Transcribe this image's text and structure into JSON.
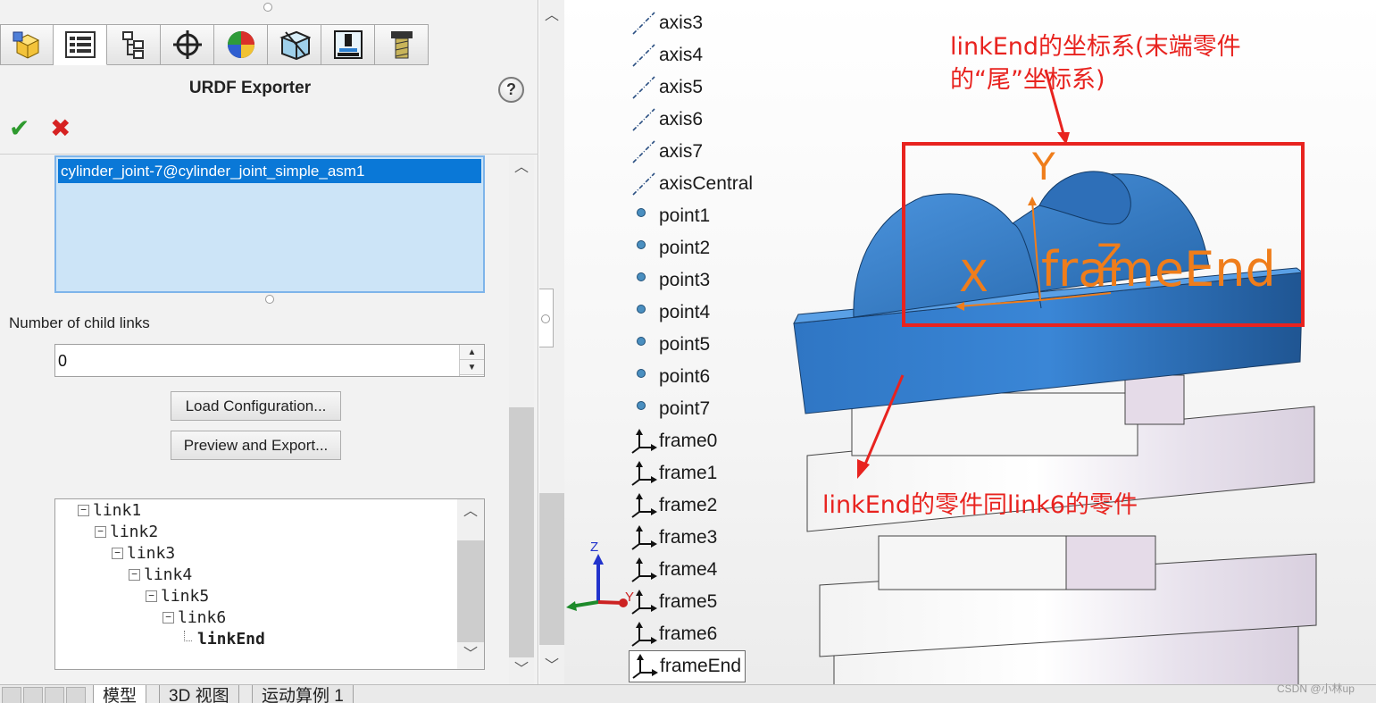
{
  "panel": {
    "title": "URDF Exporter",
    "help_label": "?",
    "ok_icon": "check-icon",
    "cancel_icon": "x-icon",
    "tabs": [
      {
        "name": "feature-manager",
        "icon": "part-cube-icon"
      },
      {
        "name": "property-manager",
        "icon": "property-list-icon"
      },
      {
        "name": "configuration-manager",
        "icon": "config-tree-icon"
      },
      {
        "name": "dimxpert-manager",
        "icon": "crosshair-icon"
      },
      {
        "name": "display-manager",
        "icon": "appearance-ball-icon"
      },
      {
        "name": "cam-manager",
        "icon": "cube-3d-icon"
      },
      {
        "name": "cam-tree",
        "icon": "machine-icon"
      },
      {
        "name": "tool-manager",
        "icon": "drill-icon"
      }
    ],
    "selection_value": "cylinder_joint-7@cylinder_joint_simple_asm1",
    "child_links_label": "Number of child links",
    "child_links_value": "0",
    "load_config_label": "Load Configuration...",
    "preview_export_label": "Preview and Export..."
  },
  "link_tree": [
    {
      "label": "link1",
      "level": 0,
      "expander": "⊟"
    },
    {
      "label": "link2",
      "level": 1,
      "expander": "⊟"
    },
    {
      "label": "link3",
      "level": 2,
      "expander": "⊟"
    },
    {
      "label": "link4",
      "level": 3,
      "expander": "⊟"
    },
    {
      "label": "link5",
      "level": 4,
      "expander": "⊟"
    },
    {
      "label": "link6",
      "level": 5,
      "expander": "⊟"
    },
    {
      "label": "linkEnd",
      "level": 6,
      "expander": ""
    }
  ],
  "bottom_tabs": [
    "模型",
    "3D 视图",
    "运动算例 1"
  ],
  "feature_tree": [
    {
      "label": "axis3",
      "type": "axis"
    },
    {
      "label": "axis4",
      "type": "axis"
    },
    {
      "label": "axis5",
      "type": "axis"
    },
    {
      "label": "axis6",
      "type": "axis"
    },
    {
      "label": "axis7",
      "type": "axis"
    },
    {
      "label": "axisCentral",
      "type": "axis"
    },
    {
      "label": "point1",
      "type": "point"
    },
    {
      "label": "point2",
      "type": "point"
    },
    {
      "label": "point3",
      "type": "point"
    },
    {
      "label": "point4",
      "type": "point"
    },
    {
      "label": "point5",
      "type": "point"
    },
    {
      "label": "point6",
      "type": "point"
    },
    {
      "label": "point7",
      "type": "point"
    },
    {
      "label": "frame0",
      "type": "frame"
    },
    {
      "label": "frame1",
      "type": "frame"
    },
    {
      "label": "frame2",
      "type": "frame"
    },
    {
      "label": "frame3",
      "type": "frame"
    },
    {
      "label": "frame4",
      "type": "frame"
    },
    {
      "label": "frame5",
      "type": "frame"
    },
    {
      "label": "frame6",
      "type": "frame"
    },
    {
      "label": "frameEnd",
      "type": "frame",
      "selected": true
    }
  ],
  "annotations": {
    "top_line1": "linkEnd的坐标系(末端零件",
    "top_line2": "的“尾”坐标系)",
    "bottom": "linkEnd的零件同link6的零件"
  },
  "frame_labels": {
    "y_axis": "Y",
    "x_axis": "X",
    "z_axis": "Z",
    "name": "frameEnd"
  },
  "triad": {
    "z": "Z",
    "y": "Y"
  },
  "watermark": "CSDN @小林up",
  "colors": {
    "annotation_red": "#e8231f",
    "frame_orange": "#ef7d1b",
    "part_blue": "#2f76c4",
    "part_lavender": "#e6e0ea",
    "selection_blue": "#0a78d7"
  }
}
